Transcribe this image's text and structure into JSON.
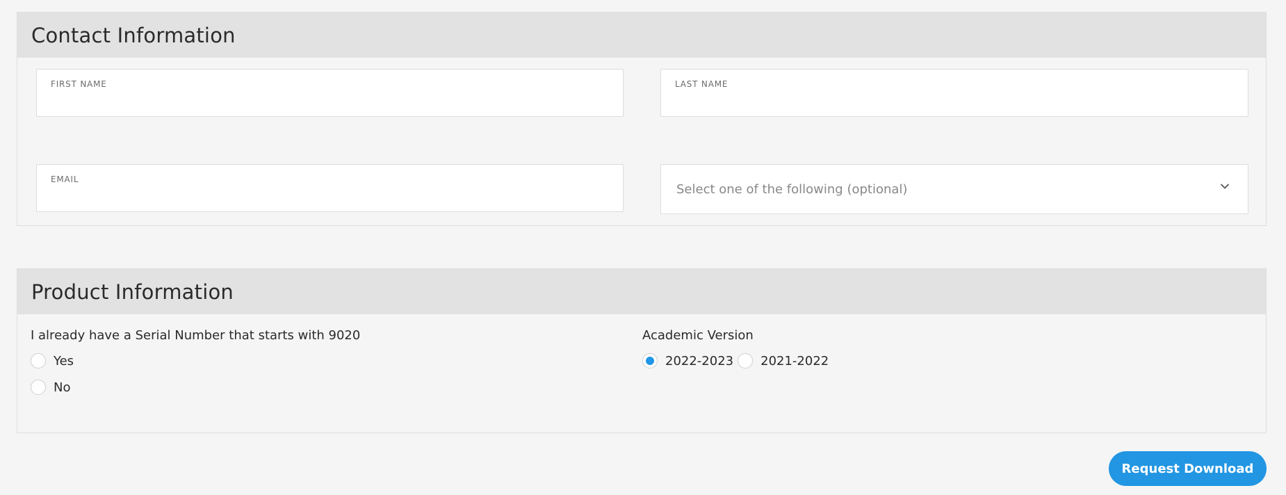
{
  "contact": {
    "title": "Contact Information",
    "first_name": {
      "label": "FIRST NAME",
      "value": ""
    },
    "last_name": {
      "label": "LAST NAME",
      "value": ""
    },
    "email": {
      "label": "EMAIL",
      "value": ""
    },
    "role_select": {
      "value": "Select one of the following (optional)",
      "icon": "chevron-down-icon"
    }
  },
  "product": {
    "title": "Product Information",
    "serial_question": {
      "label": "I already have a Serial Number that starts with 9020",
      "options": [
        {
          "label": "Yes",
          "checked": false
        },
        {
          "label": "No",
          "checked": false
        }
      ]
    },
    "academic_version": {
      "label": "Academic Version",
      "options": [
        {
          "label": "2022-2023",
          "checked": true
        },
        {
          "label": "2021-2022",
          "checked": false
        }
      ]
    }
  },
  "actions": {
    "submit_label": "Request Download"
  },
  "colors": {
    "accent": "#2296e3",
    "header_bg": "#e2e2e2",
    "page_bg": "#f5f5f5"
  }
}
